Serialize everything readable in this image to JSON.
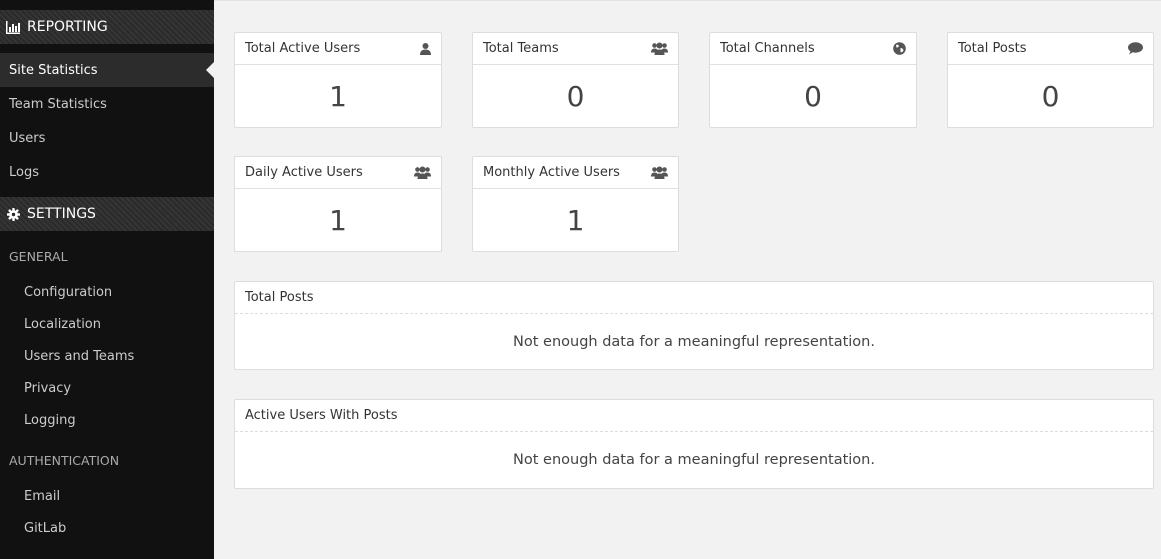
{
  "sidebar": {
    "reporting_header": "REPORTING",
    "reporting_items": [
      "Site Statistics",
      "Team Statistics",
      "Users",
      "Logs"
    ],
    "settings_header": "SETTINGS",
    "general_label": "GENERAL",
    "general_items": [
      "Configuration",
      "Localization",
      "Users and Teams",
      "Privacy",
      "Logging"
    ],
    "authentication_label": "AUTHENTICATION",
    "authentication_items": [
      "Email",
      "GitLab"
    ]
  },
  "stats": {
    "total_active_users": {
      "title": "Total Active Users",
      "value": "1",
      "icon": "user-icon"
    },
    "total_teams": {
      "title": "Total Teams",
      "value": "0",
      "icon": "users-icon"
    },
    "total_channels": {
      "title": "Total Channels",
      "value": "0",
      "icon": "globe-icon"
    },
    "total_posts": {
      "title": "Total Posts",
      "value": "0",
      "icon": "comment-icon"
    },
    "daily_active_users": {
      "title": "Daily Active Users",
      "value": "1",
      "icon": "users-icon"
    },
    "monthly_active_users": {
      "title": "Monthly Active Users",
      "value": "1",
      "icon": "users-icon"
    }
  },
  "charts": {
    "total_posts": {
      "title": "Total Posts",
      "message": "Not enough data for a meaningful representation."
    },
    "active_users_with_posts": {
      "title": "Active Users With Posts",
      "message": "Not enough data for a meaningful representation."
    }
  },
  "colors": {
    "sidebar_bg": "#111111",
    "content_bg": "#f2f2f2",
    "card_bg": "#ffffff"
  }
}
